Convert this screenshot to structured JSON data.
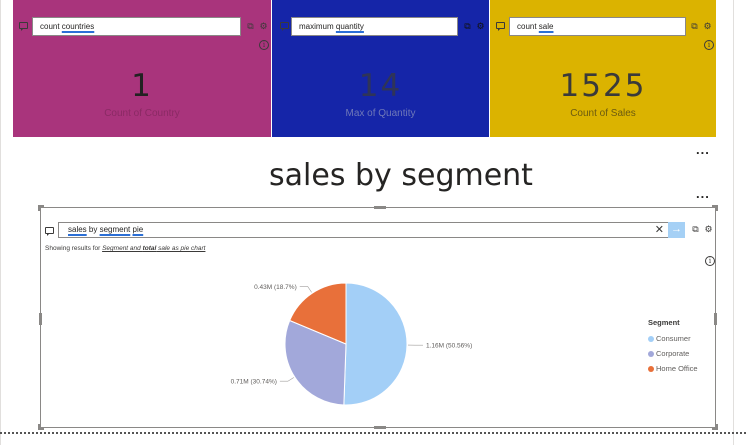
{
  "cards": [
    {
      "query_parts": [
        "count ",
        "countries"
      ],
      "underlined": [
        false,
        true
      ],
      "value": "1",
      "label": "Count of Country",
      "color": "#a9347c"
    },
    {
      "query_parts": [
        "maximum ",
        "quantity"
      ],
      "underlined": [
        false,
        true
      ],
      "value": "14",
      "label": "Max of Quantity",
      "color": "#1525a8"
    },
    {
      "query_parts": [
        "count ",
        "sale"
      ],
      "underlined": [
        false,
        true
      ],
      "value": "1525",
      "label": "Count of Sales",
      "color": "#dbb300"
    }
  ],
  "page_title": "sales by segment",
  "qna": {
    "query_parts": [
      "sales",
      " by ",
      "segment",
      " ",
      "pie"
    ],
    "showing_prefix": "Showing results for ",
    "showing_a": "Segment and ",
    "showing_b": "total",
    "showing_c": " sale as pie chart",
    "clear_icon": "close-icon",
    "submit_icon": "arrow-right-icon"
  },
  "chart_data": {
    "type": "pie",
    "legend_title": "Segment",
    "legend_position": "right",
    "slices": [
      {
        "name": "Consumer",
        "value": 1.16,
        "label": "1.16M (50.56%)",
        "percent": 50.56,
        "color": "#a3cff7"
      },
      {
        "name": "Corporate",
        "value": 0.71,
        "label": "0.71M (30.74%)",
        "percent": 30.74,
        "color": "#a2a8da"
      },
      {
        "name": "Home Office",
        "value": 0.43,
        "label": "0.43M (18.7%)",
        "percent": 18.7,
        "color": "#e8703a"
      }
    ]
  },
  "more_options_label": "..."
}
